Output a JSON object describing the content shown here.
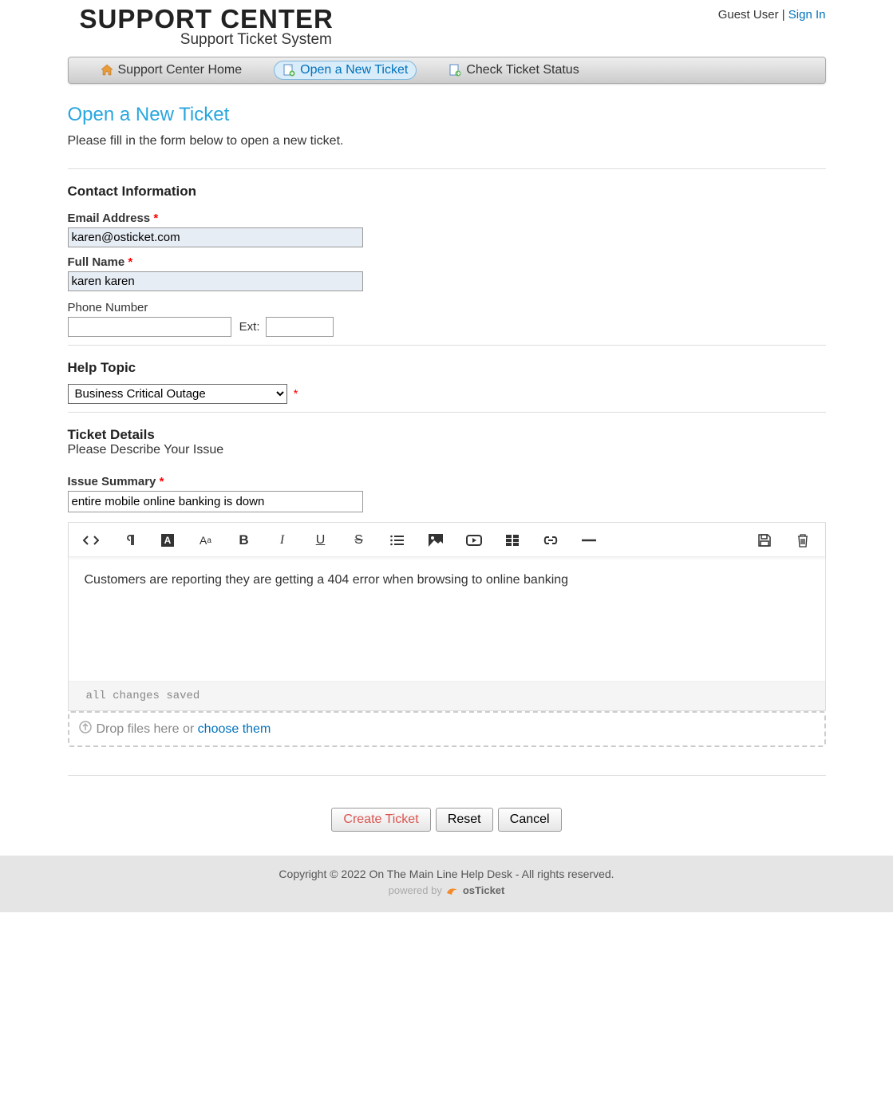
{
  "header": {
    "logo_title": "SUPPORT CENTER",
    "logo_subtitle": "Support Ticket System",
    "user_label": "Guest User",
    "separator": " | ",
    "signin_label": "Sign In"
  },
  "nav": {
    "home": "Support Center Home",
    "open": "Open a New Ticket",
    "status": "Check Ticket Status"
  },
  "page": {
    "title": "Open a New Ticket",
    "description": "Please fill in the form below to open a new ticket."
  },
  "contact": {
    "section_title": "Contact Information",
    "email_label": "Email Address ",
    "email_value": "karen@osticket.com",
    "name_label": "Full Name ",
    "name_value": "karen karen",
    "phone_label": "Phone Number",
    "phone_value": "",
    "ext_label": "Ext:",
    "ext_value": ""
  },
  "topic": {
    "section_title": "Help Topic",
    "selected": "Business Critical Outage"
  },
  "details": {
    "section_title": "Ticket Details",
    "section_desc": "Please Describe Your Issue",
    "summary_label": "Issue Summary ",
    "summary_value": "entire mobile online banking is down",
    "body_text": "Customers are reporting they are getting a 404 error when browsing to online banking",
    "status_text": "all changes saved",
    "drop_text": "Drop files here or ",
    "choose_text": "choose them"
  },
  "buttons": {
    "create": "Create Ticket",
    "reset": "Reset",
    "cancel": "Cancel"
  },
  "footer": {
    "copyright": "Copyright © 2022 On The Main Line Help Desk - All rights reserved.",
    "powered": "powered by",
    "brand": "osTicket"
  },
  "asterisk": "*"
}
